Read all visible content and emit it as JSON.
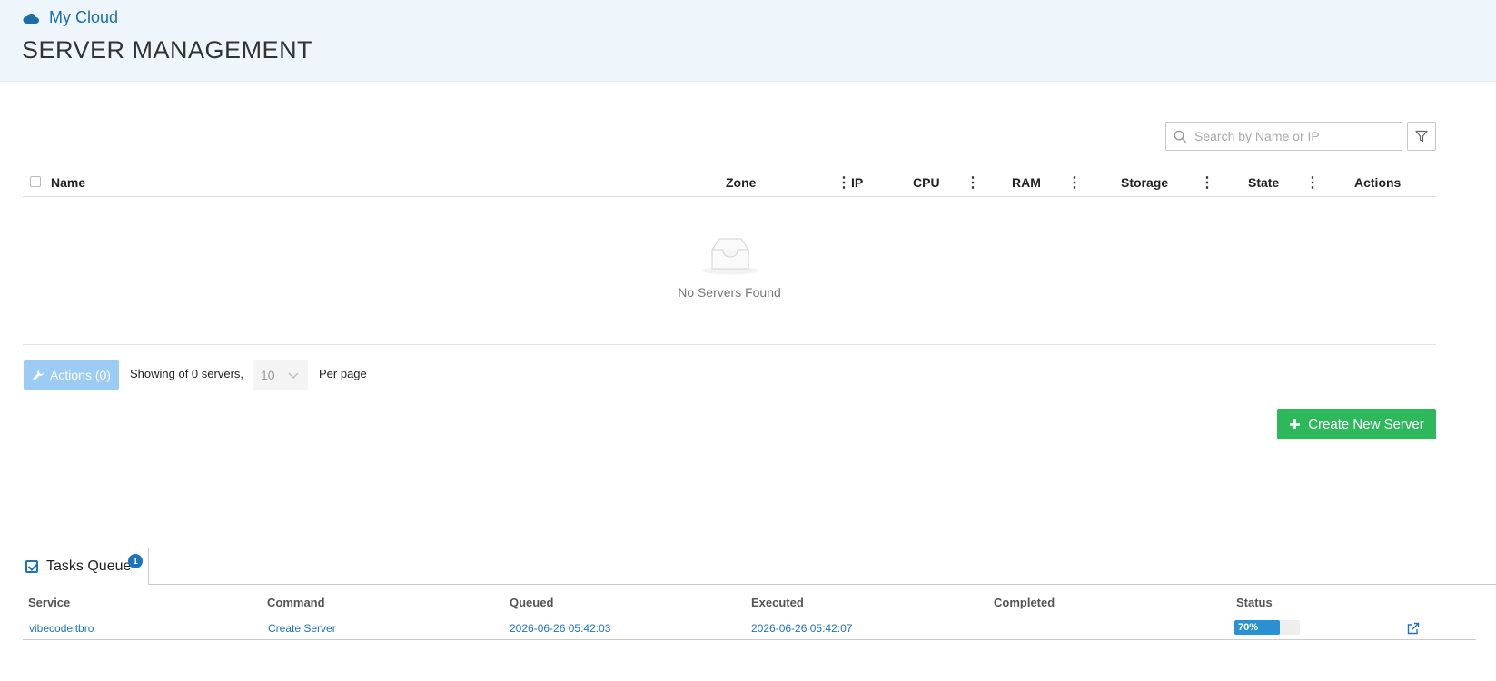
{
  "header": {
    "brand": "My Cloud",
    "title": "SERVER MANAGEMENT"
  },
  "search": {
    "placeholder": "Search by Name or IP",
    "value": ""
  },
  "table": {
    "columns": [
      "Name",
      "Zone",
      "IP",
      "CPU",
      "RAM",
      "Storage",
      "State",
      "Actions"
    ],
    "empty_text": "No Servers Found"
  },
  "footer": {
    "actions_label": "Actions (0)",
    "showing_text": "Showing of 0 servers,",
    "per_page_value": "10",
    "per_page_label": "Per page",
    "create_label": "Create New Server"
  },
  "tasks": {
    "tab_label": "Tasks Queue",
    "badge_count": "1",
    "columns": [
      "Service",
      "Command",
      "Queued",
      "Executed",
      "Completed",
      "Status"
    ],
    "rows": [
      {
        "service": "vibecodeitbro",
        "command": "Create Server",
        "queued": "2026-06-26 05:42:03",
        "executed": "2026-06-26 05:42:07",
        "completed": "",
        "status_label": "70%",
        "progress": 0.7
      }
    ]
  },
  "colors": {
    "header_bg": "#eef6fc",
    "brand": "#1a6fa8",
    "accent": "#1e73be",
    "create_button": "#2eb85c",
    "actions_button_disabled": "#9ccbf3",
    "progress_fill": "#2990d4"
  },
  "icons": {
    "brand": "cloud-icon",
    "search": "search-icon",
    "filter": "filter-icon",
    "empty": "empty-inbox-icon",
    "actions": "wrench-icon",
    "create": "plus-icon",
    "tasks": "checkbox-checked-icon",
    "row_link": "external-link-icon"
  }
}
